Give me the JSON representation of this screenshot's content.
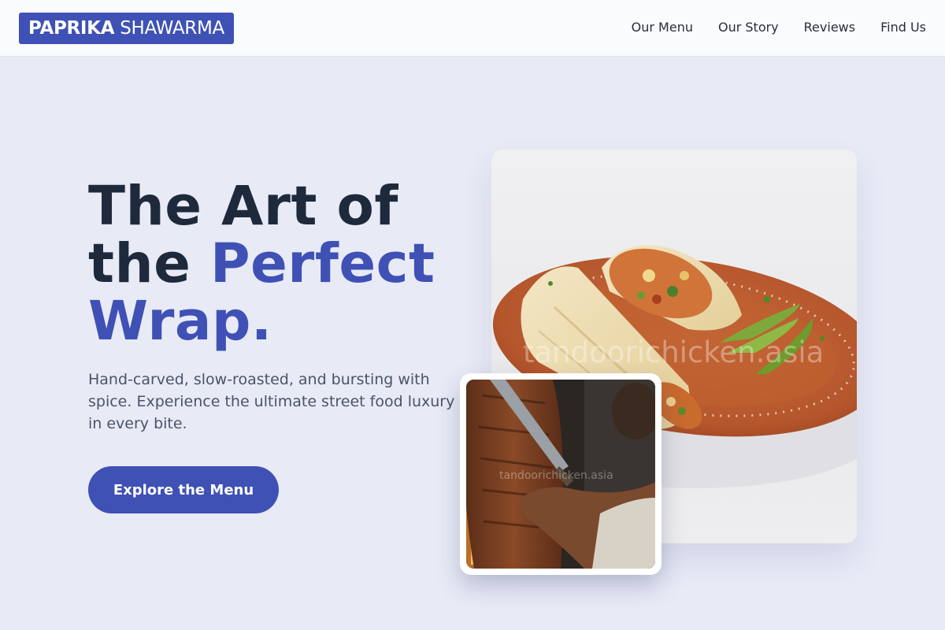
{
  "brand": {
    "name_bold": "PAPRIKA",
    "name_light": "SHAWARMA",
    "color": "#3f51b5"
  },
  "nav": {
    "items": [
      {
        "label": "Our Menu"
      },
      {
        "label": "Our Story"
      },
      {
        "label": "Reviews"
      },
      {
        "label": "Find Us"
      }
    ]
  },
  "hero": {
    "headline_part1": "The Art of the ",
    "headline_accent": "Perfect Wrap.",
    "subtitle": "Hand-carved, slow-roasted, and bursting with spice. Experience the ultimate street food luxury in every bite.",
    "cta_label": "Explore the Menu"
  },
  "images": {
    "main": {
      "watermark": "tandoorichicken.asia",
      "subject": "shawarma-wrap-on-plate"
    },
    "secondary": {
      "watermark": "tandoorichicken.asia",
      "subject": "carving-shawarma-spit"
    }
  },
  "colors": {
    "accent": "#3f51b5",
    "text_dark": "#1e2a3b",
    "background": "#e8eaf6"
  }
}
